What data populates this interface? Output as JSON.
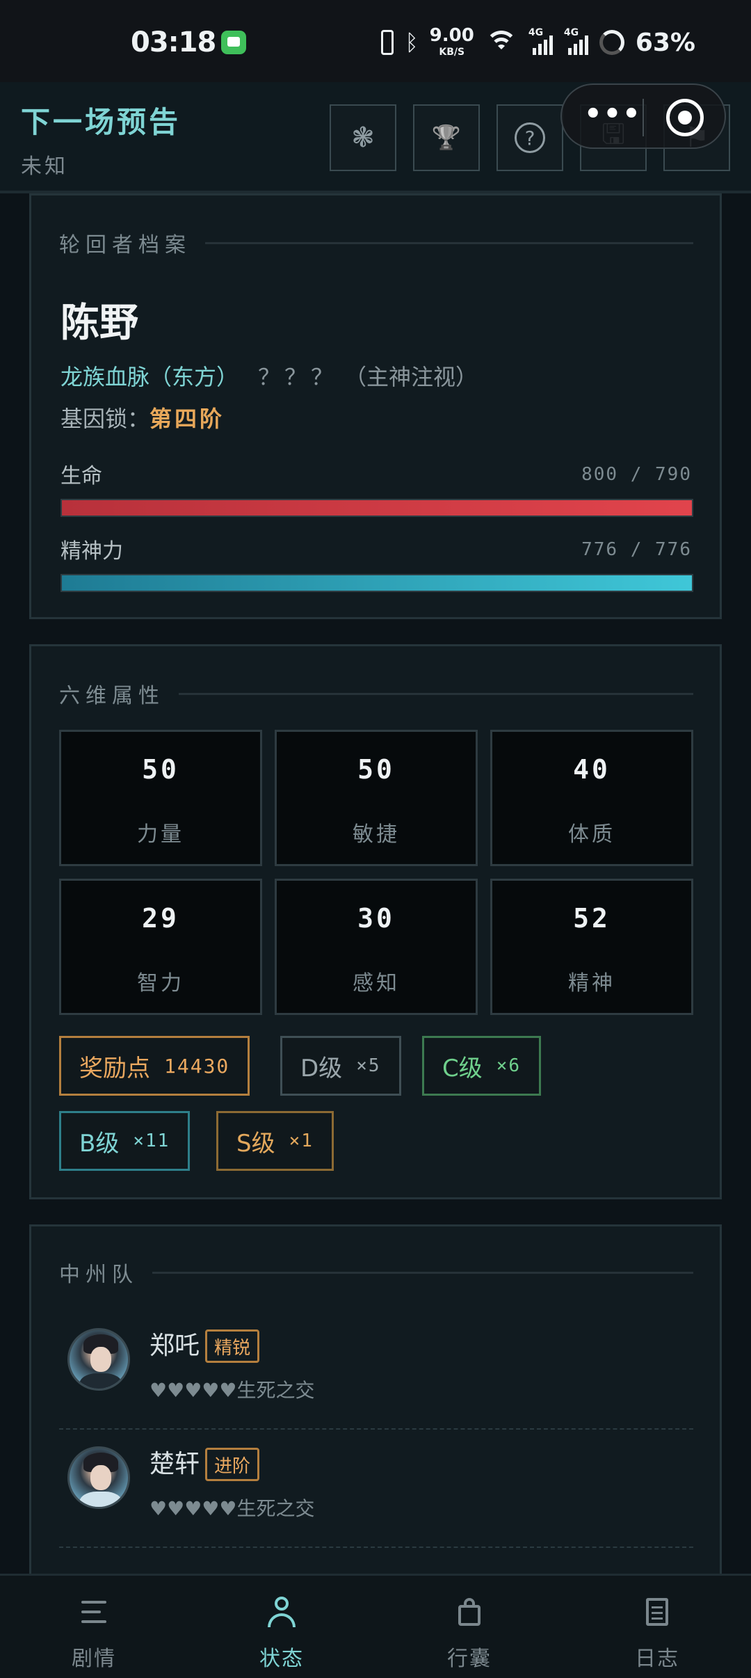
{
  "status_bar": {
    "time": "03:18",
    "net_speed": "9.00",
    "net_unit": "KB/S",
    "signal1": "4G",
    "signal2": "4G",
    "battery": "63%"
  },
  "header": {
    "title": "下一场预告",
    "subtitle": "未知",
    "buttons": [
      {
        "icon": "settings-wheel-icon",
        "glyph": "❃"
      },
      {
        "icon": "trophy-icon",
        "glyph": "🏆"
      },
      {
        "icon": "help-icon",
        "glyph": "?"
      },
      {
        "icon": "save-icon",
        "glyph": "🖫"
      },
      {
        "icon": "bookmark-icon",
        "glyph": "⚑"
      }
    ]
  },
  "profile": {
    "section_title": "轮回者档案",
    "name": "陈野",
    "bloodline": "龙族血脉（东方）",
    "unknown": "？？？",
    "watch": "（主神注视）",
    "gene_lock_label": "基因锁：",
    "gene_lock_value": "第四阶",
    "hp_label": "生命",
    "hp_value": "800 / 790",
    "hp_fraction": 1.0,
    "mp_label": "精神力",
    "mp_value": "776 / 776",
    "mp_fraction": 1.0
  },
  "attributes": {
    "section_title": "六维属性",
    "stats": [
      {
        "value": "50",
        "name": "力量"
      },
      {
        "value": "50",
        "name": "敏捷"
      },
      {
        "value": "40",
        "name": "体质"
      },
      {
        "value": "29",
        "name": "智力"
      },
      {
        "value": "30",
        "name": "感知"
      },
      {
        "value": "52",
        "name": "精神"
      }
    ],
    "reward_label": "奖励点",
    "reward_value": "14430",
    "chips": [
      {
        "grade": "D级",
        "count": "×5"
      },
      {
        "grade": "C级",
        "count": "×6"
      },
      {
        "grade": "B级",
        "count": "×11"
      },
      {
        "grade": "S级",
        "count": "×1"
      }
    ]
  },
  "team": {
    "section_title": "中州队",
    "members": [
      {
        "name": "郑吒",
        "tag": "精锐",
        "bond": "♥♥♥♥♥生死之交"
      },
      {
        "name": "楚轩",
        "tag": "进阶",
        "bond": "♥♥♥♥♥生死之交"
      }
    ]
  },
  "nav": [
    {
      "label": "剧情",
      "icon": "menu-icon"
    },
    {
      "label": "状态",
      "icon": "user-icon"
    },
    {
      "label": "行囊",
      "icon": "bag-icon"
    },
    {
      "label": "日志",
      "icon": "log-icon"
    }
  ],
  "colors": {
    "accent": "#7fd4d4",
    "gold": "#eaa85f",
    "hp": "#e1444c",
    "mp": "#3fc7d8",
    "background": "#0c1318"
  }
}
